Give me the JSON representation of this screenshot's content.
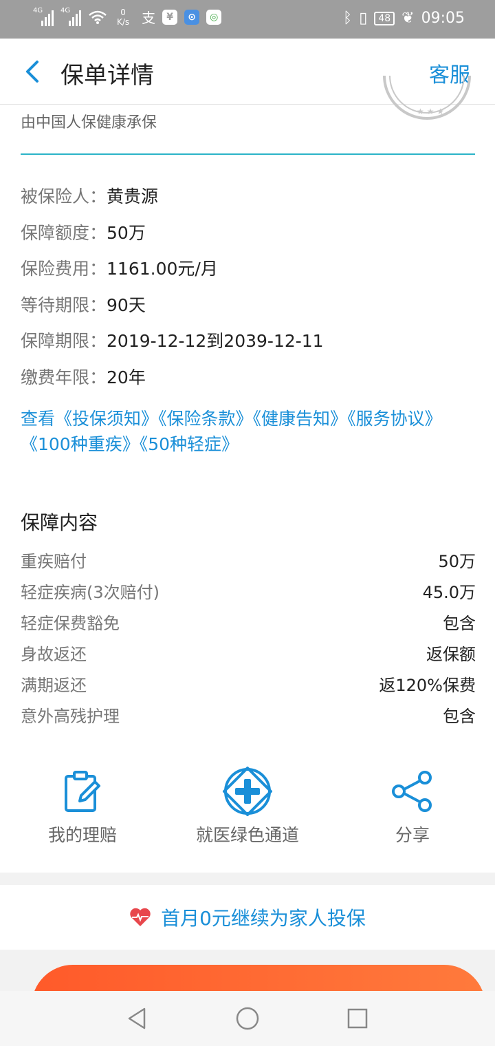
{
  "status_bar": {
    "net1": "4G",
    "net2": "4G",
    "speed_value": "0",
    "speed_unit": "K/s",
    "battery": "48",
    "time": "09:05"
  },
  "header": {
    "title": "保单详情",
    "service": "客服"
  },
  "insurer": "由中国人保健康承保",
  "info": [
    {
      "label": "被保险人：",
      "value": "黄贵源"
    },
    {
      "label": "保障额度：",
      "value": "50万"
    },
    {
      "label": "保险费用：",
      "value": "1161.00元/月"
    },
    {
      "label": "等待期限：",
      "value": "90天"
    },
    {
      "label": "保障期限：",
      "value": "2019-12-12到2039-12-11"
    },
    {
      "label": "缴费年限：",
      "value": "20年"
    }
  ],
  "docs": {
    "prefix": "查看",
    "links": [
      "《投保须知》",
      "《保险条款》",
      "《健康告知》",
      "《服务协议》",
      "《100种重疾》",
      "《50种轻症》"
    ]
  },
  "coverage": {
    "title": "保障内容",
    "rows": [
      {
        "label": "重疾赔付",
        "value": "50万"
      },
      {
        "label": "轻症疾病(3次赔付)",
        "value": "45.0万"
      },
      {
        "label": "轻症保费豁免",
        "value": "包含"
      },
      {
        "label": "身故返还",
        "value": "返保额"
      },
      {
        "label": "满期返还",
        "value": "返120%保费"
      },
      {
        "label": "意外高残护理",
        "value": "包含"
      }
    ]
  },
  "actions": {
    "claim": "我的理赔",
    "green_channel": "就医绿色通道",
    "share": "分享"
  },
  "promo": "首月0元继续为家人投保",
  "colors": {
    "accent": "#1a8fd8",
    "divider": "#2bb3c8",
    "heart": "#e8474c"
  }
}
